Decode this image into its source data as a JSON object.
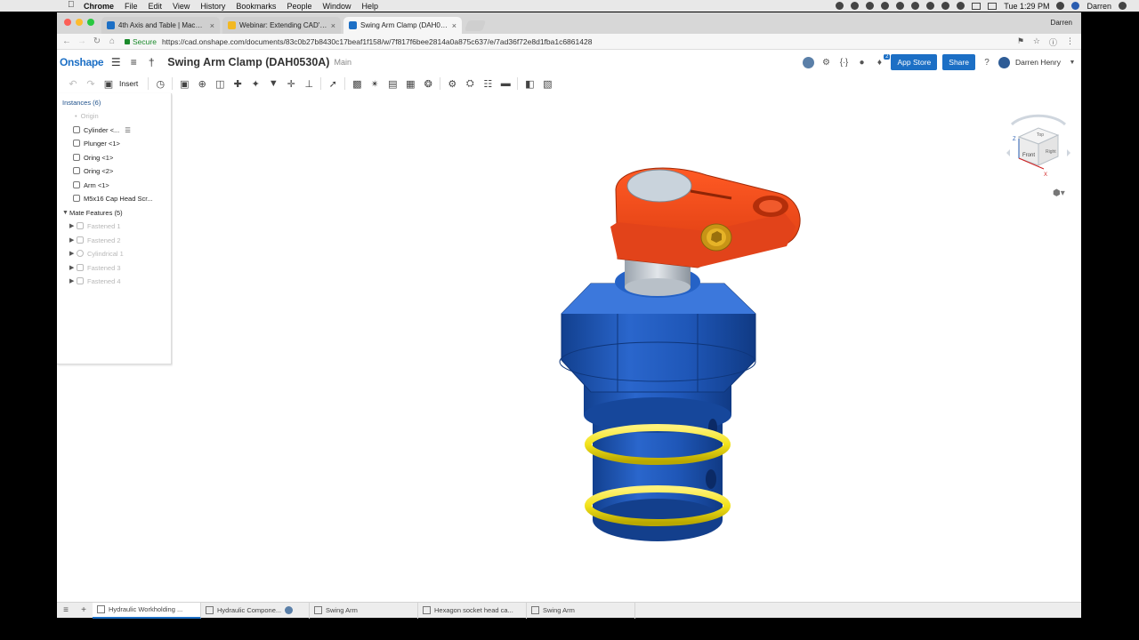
{
  "menubar": {
    "app": "Chrome",
    "items": [
      "File",
      "Edit",
      "View",
      "History",
      "Bookmarks",
      "People",
      "Window",
      "Help"
    ],
    "clock": "Tue 1:29 PM",
    "user": "Darren"
  },
  "browser": {
    "tabs": [
      {
        "title": "4th Axis and Table | Machine To",
        "favicon_color": "#1c6fc5"
      },
      {
        "title": "Webinar: Extending CAD's Bus",
        "favicon_color": "#f2b822"
      },
      {
        "title": "Swing Arm Clamp (DAH0530A",
        "favicon_color": "#1c6fc5"
      }
    ],
    "profile": "Darren",
    "secure_label": "Secure",
    "url": "https://cad.onshape.com/documents/83c0b27b8430c17beaf1f158/w/7f817f6bee2814a0a875c637/e/7ad36f72e8d1fba1c6861428"
  },
  "header": {
    "logo": "Onshape",
    "doc_title": "Swing Arm Clamp (DAH0530A)",
    "branch": "Main",
    "notification_count": "2",
    "app_store": "App Store",
    "share": "Share",
    "user_name": "Darren Henry"
  },
  "toolbar": {
    "insert_label": "Insert"
  },
  "instances": {
    "heading": "Instances (6)",
    "items": [
      {
        "label": "Origin",
        "dim": true
      },
      {
        "label": "Cylinder <..."
      },
      {
        "label": "Plunger <1>"
      },
      {
        "label": "Oring <1>"
      },
      {
        "label": "Oring <2>"
      },
      {
        "label": "Arm <1>"
      },
      {
        "label": "M5x16 Cap Head Scr..."
      }
    ]
  },
  "mates": {
    "heading": "Mate Features (5)",
    "items": [
      "Fastened 1",
      "Fastened 2",
      "Cylindrical 1",
      "Fastened 3",
      "Fastened 4"
    ]
  },
  "viewcube": {
    "front": "Front",
    "top": "Top",
    "right": "Right",
    "axis_z": "Z",
    "axis_x": "X"
  },
  "bottom_tabs": [
    {
      "label": "Hydraulic Workholding ...",
      "active": true
    },
    {
      "label": "Hydraulic Compone..."
    },
    {
      "label": "Swing Arm"
    },
    {
      "label": "Hexagon socket head ca..."
    },
    {
      "label": "Swing Arm"
    }
  ],
  "colors": {
    "accent": "#1c6fc5",
    "body_blue": "#1f57b8",
    "arm_orange": "#f04a1e",
    "oring_yellow": "#f2e21a"
  }
}
